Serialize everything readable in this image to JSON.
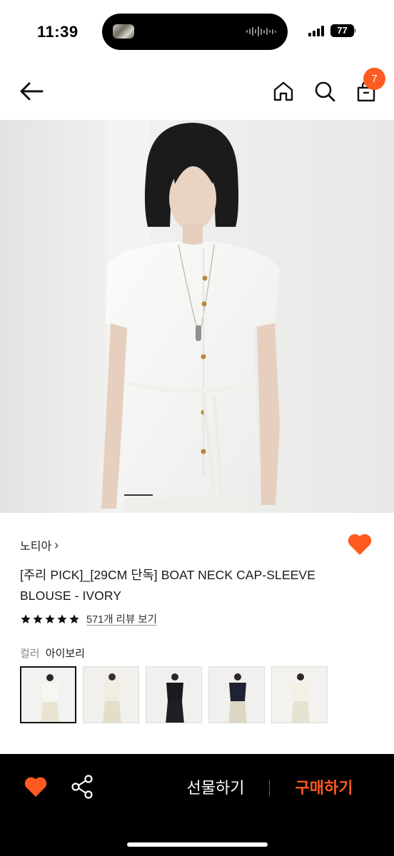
{
  "status_bar": {
    "time": "11:39",
    "battery": "77"
  },
  "header": {
    "back_icon": "arrow-left-icon",
    "home_icon": "home-icon",
    "search_icon": "search-icon",
    "cart_icon": "shopping-bag-icon",
    "cart_count": "7"
  },
  "product": {
    "brand": "노티아",
    "brand_chevron": "›",
    "title": "[주리 PICK]_[29CM 단독] BOAT NECK CAP-SLEEVE BLOUSE - IVORY",
    "rating_stars": 5,
    "review_link": "571개 리뷰 보기",
    "color_label": "컬러",
    "color_value": "아이보리",
    "image_progress": 0.07,
    "wishlisted": true,
    "swatches": [
      {
        "name": "ivory",
        "top": "#f4f2ea",
        "bottom": "#e7e2d2",
        "selected": true
      },
      {
        "name": "cream",
        "top": "#f1eee6",
        "bottom": "#e4ddcc",
        "selected": false
      },
      {
        "name": "black",
        "top": "#1b1b1f",
        "bottom": "#1b1b1f",
        "selected": false
      },
      {
        "name": "navy",
        "top": "#1e2233",
        "bottom": "#d8d2c0",
        "selected": false
      },
      {
        "name": "ivory-alt",
        "top": "#f3efe3",
        "bottom": "#e6e1cf",
        "selected": false
      }
    ]
  },
  "bottom_bar": {
    "heart_icon": "heart-icon",
    "share_icon": "share-icon",
    "gift_label": "선물하기",
    "buy_label": "구매하기"
  },
  "colors": {
    "accent": "#ff5a1f",
    "bottom_bar_bg": "#000000"
  }
}
